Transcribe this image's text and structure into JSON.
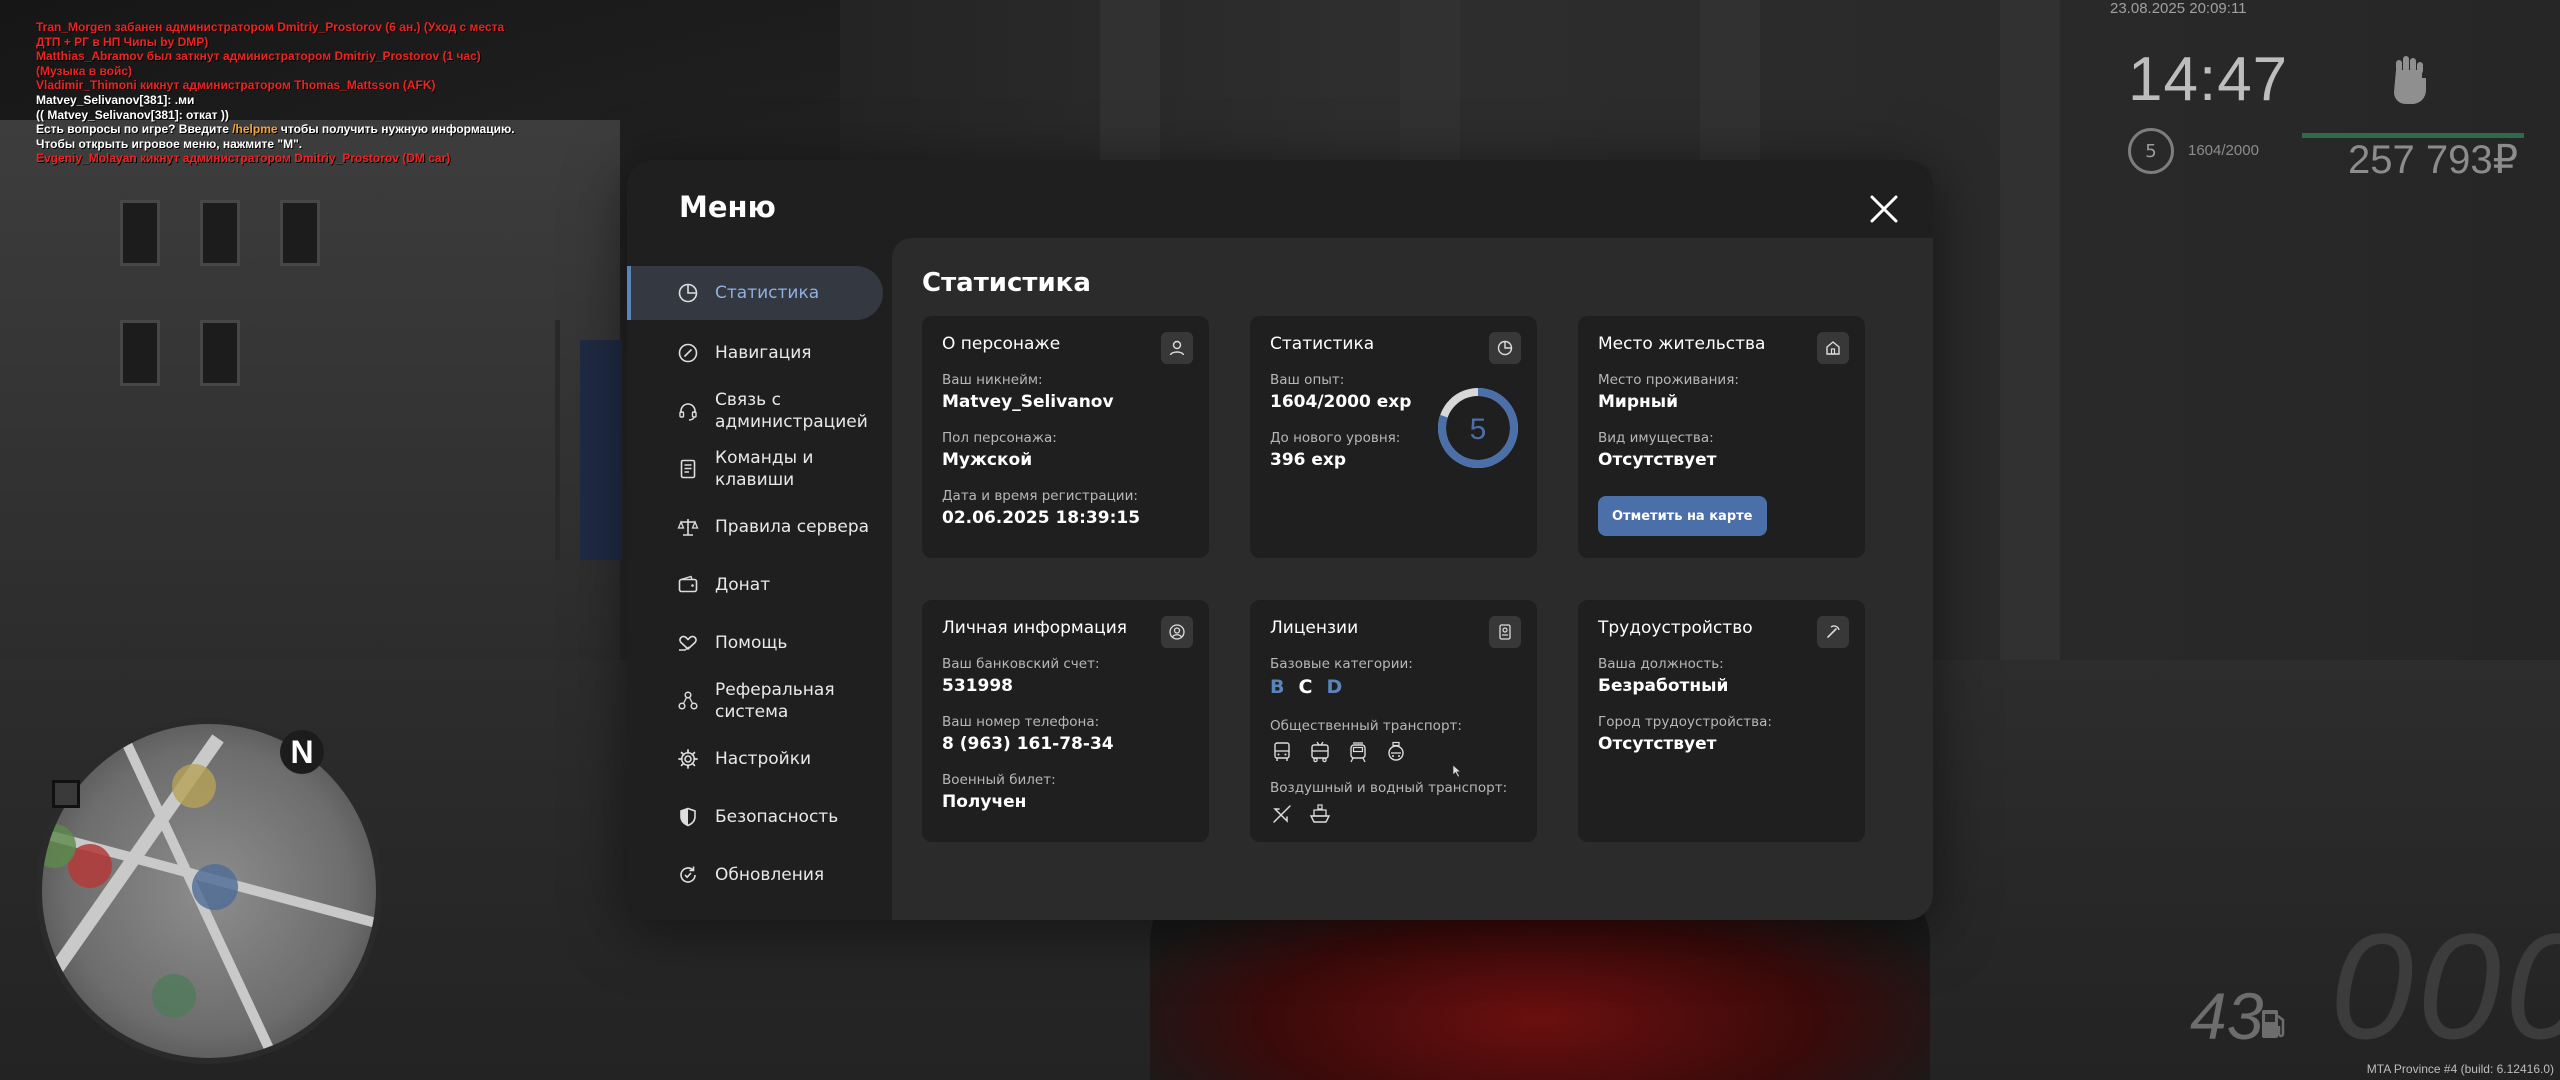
{
  "chat": [
    {
      "text": "Tran_Morgen забанен администратором Dmitriy_Prostorov (6 ан.) (Уход с места",
      "color": "red"
    },
    {
      "text": "ДТП + РГ в НП Чипы by DMP)",
      "color": "red"
    },
    {
      "text": "Matthias_Abramov был заткнут администратором Dmitriy_Prostorov (1 час)",
      "color": "red"
    },
    {
      "text": "(Музыка в войс)",
      "color": "red"
    },
    {
      "text": "Vladimir_Thimoni кикнут администратором Thomas_Mattsson (AFK)",
      "color": "red"
    },
    {
      "text": "Matvey_Selivanov[381]: .ми",
      "color": "white"
    },
    {
      "text": "(( Matvey_Selivanov[381]: откат ))",
      "color": "white"
    },
    {
      "text_before": "Есть вопросы по игре? Введите ",
      "highlight": "/helpme",
      "text_after": " чтобы получить нужную информацию."
    },
    {
      "text": "Чтобы открыть игровое меню, нажмите \"M\".",
      "color": "white"
    },
    {
      "text": "Evgeniy_Molayan кикнут администратором Dmitriy_Prostorov (DM car)",
      "color": "red"
    }
  ],
  "hud": {
    "datetime": "23.08.2025 20:09:11",
    "time": "14:47",
    "level": "5",
    "exp": "1604/2000",
    "money": "257 793₽",
    "speed": "43",
    "speed_bg": "000",
    "build": "MTA Province #4 (build: 6.12416.0)"
  },
  "minimap": {
    "north": "N"
  },
  "menu": {
    "title": "Меню",
    "sidebar": [
      {
        "label": "Статистика",
        "icon": "pie-chart-icon",
        "active": true
      },
      {
        "label": "Навигация",
        "icon": "compass-icon"
      },
      {
        "label": "Связь с\nадминистрацией",
        "icon": "headset-icon"
      },
      {
        "label": "Команды и\nклавиши",
        "icon": "document-icon"
      },
      {
        "label": "Правила сервера",
        "icon": "scales-icon"
      },
      {
        "label": "Донат",
        "icon": "wallet-icon"
      },
      {
        "label": "Помощь",
        "icon": "heart-hand-icon"
      },
      {
        "label": "Реферальная\nсистема",
        "icon": "referral-icon"
      },
      {
        "label": "Настройки",
        "icon": "gear-icon"
      },
      {
        "label": "Безопасность",
        "icon": "shield-icon"
      },
      {
        "label": "Обновления",
        "icon": "refresh-icon"
      }
    ],
    "section_title": "Статистика",
    "cards": {
      "character": {
        "title": "О персонаже",
        "nick_label": "Ваш никнейм:",
        "nick": "Matvey_Selivanov",
        "gender_label": "Пол персонажа:",
        "gender": "Мужской",
        "reg_label": "Дата и время регистрации:",
        "reg": "02.06.2025 18:39:15"
      },
      "stats": {
        "title": "Статистика",
        "exp_label": "Ваш опыт:",
        "exp": "1604/2000 exp",
        "next_label": "До нового уровня:",
        "next": "396 exp",
        "level": "5",
        "progress": 0.802
      },
      "residence": {
        "title": "Место жительства",
        "place_label": "Место проживания:",
        "place": "Мирный",
        "property_label": "Вид имущества:",
        "property": "Отсутствует",
        "button": "Отметить на карте"
      },
      "personal": {
        "title": "Личная информация",
        "bank_label": "Ваш банковский счет:",
        "bank": "531998",
        "phone_label": "Ваш номер телефона:",
        "phone": "8 (963) 161-78-34",
        "military_label": "Военный билет:",
        "military": "Получен"
      },
      "licenses": {
        "title": "Лицензии",
        "base_label": "Базовые категории:",
        "categories": [
          {
            "letter": "B",
            "color": "#5b84bd"
          },
          {
            "letter": "C",
            "color": "#ffffff"
          },
          {
            "letter": "D",
            "color": "#5b84bd"
          }
        ],
        "public_label": "Общественный транспорт:",
        "air_label": "Воздушный и водный транспорт:"
      },
      "employment": {
        "title": "Трудоустройство",
        "position_label": "Ваша должность:",
        "position": "Безработный",
        "city_label": "Город трудоустройства:",
        "city": "Отсутствует"
      }
    }
  },
  "colors": {
    "accent": "#5b84bd",
    "button": "#4b6fa8",
    "chat_red": "#ee2222",
    "chat_orange": "#f2a33a"
  }
}
